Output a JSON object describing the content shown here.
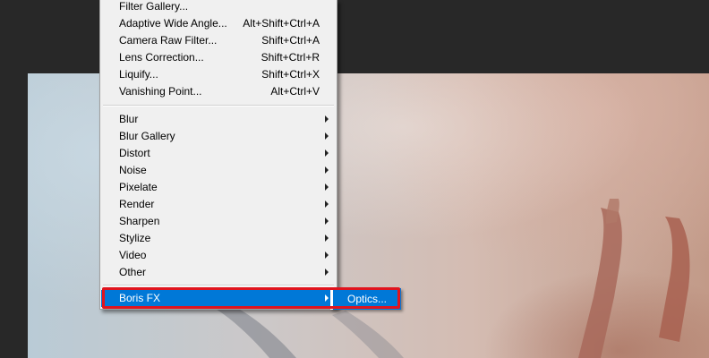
{
  "filter_menu": {
    "top_items": [
      {
        "label": "Filter Gallery...",
        "shortcut": ""
      },
      {
        "label": "Adaptive Wide Angle...",
        "shortcut": "Alt+Shift+Ctrl+A"
      },
      {
        "label": "Camera Raw Filter...",
        "shortcut": "Shift+Ctrl+A"
      },
      {
        "label": "Lens Correction...",
        "shortcut": "Shift+Ctrl+R"
      },
      {
        "label": "Liquify...",
        "shortcut": "Shift+Ctrl+X"
      },
      {
        "label": "Vanishing Point...",
        "shortcut": "Alt+Ctrl+V"
      }
    ],
    "submenu_items": [
      "Blur",
      "Blur Gallery",
      "Distort",
      "Noise",
      "Pixelate",
      "Render",
      "Sharpen",
      "Stylize",
      "Video",
      "Other"
    ],
    "plugin_item": {
      "label": "Boris FX",
      "selected": true
    }
  },
  "boris_fx_submenu": {
    "items": [
      "Optics..."
    ]
  },
  "highlight_color": "#e0141e",
  "selection_color": "#0078d7"
}
